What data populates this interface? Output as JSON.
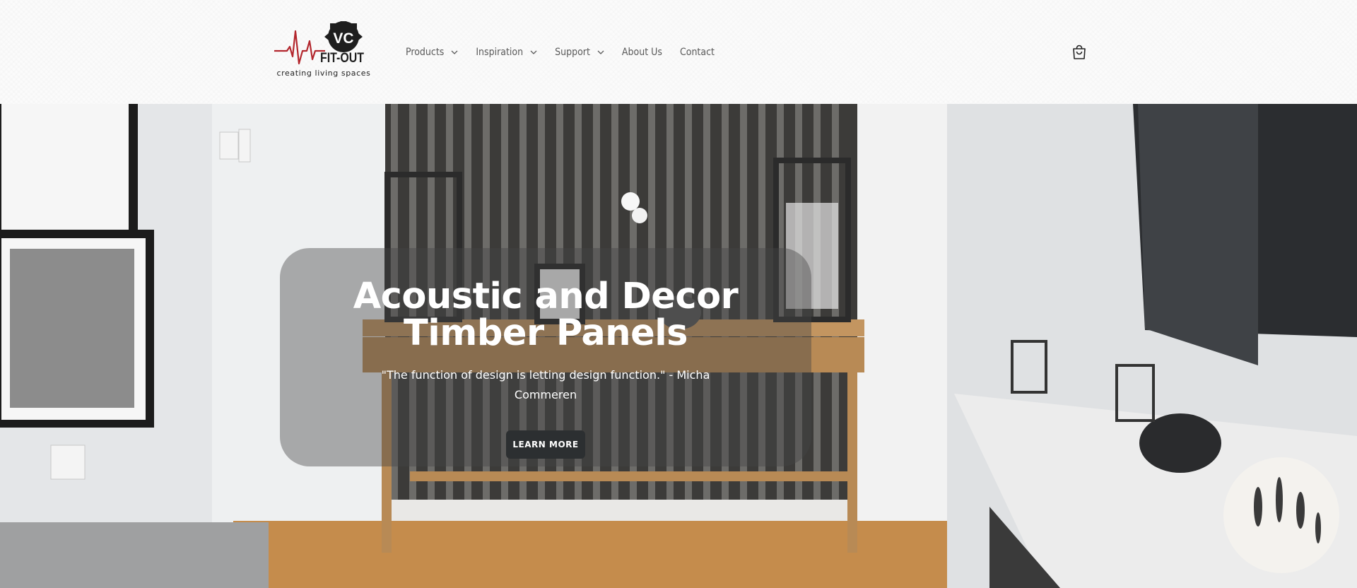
{
  "header": {
    "logo": {
      "top_text": "VC",
      "main_text": "FIT-OUT",
      "tagline": "creating living spaces",
      "accent_color": "#b3262d"
    },
    "nav": [
      {
        "label": "Products",
        "has_dropdown": true
      },
      {
        "label": "Inspiration",
        "has_dropdown": true
      },
      {
        "label": "Support",
        "has_dropdown": true
      },
      {
        "label": "About Us",
        "has_dropdown": false
      },
      {
        "label": "Contact",
        "has_dropdown": false
      }
    ],
    "cart_icon": "shopping-bag-icon"
  },
  "hero": {
    "title": "Acoustic and Decor Timber Panels",
    "subtitle": "\"The function of design is letting design function.\" - Micha Commeren",
    "button_label": "LEARN MORE"
  }
}
